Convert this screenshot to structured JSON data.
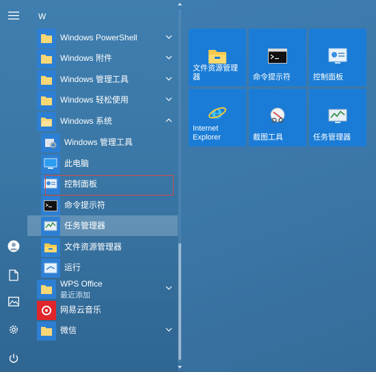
{
  "app_list": {
    "section_letter": "W",
    "items": [
      {
        "label": "Windows PowerShell",
        "icon": "folder-icon"
      },
      {
        "label": "Windows 附件",
        "icon": "folder-icon"
      },
      {
        "label": "Windows 管理工具",
        "icon": "folder-icon"
      },
      {
        "label": "Windows 轻松使用",
        "icon": "folder-icon"
      },
      {
        "label": "Windows 系统",
        "icon": "folder-icon"
      },
      {
        "label": "Windows 管理工具",
        "icon": "admin-tools-icon"
      },
      {
        "label": "此电脑",
        "icon": "this-pc-icon"
      },
      {
        "label": "控制面板",
        "icon": "control-panel-icon"
      },
      {
        "label": "命令提示符",
        "icon": "cmd-icon"
      },
      {
        "label": "任务管理器",
        "icon": "task-manager-icon"
      },
      {
        "label": "文件资源管理器",
        "icon": "file-explorer-icon"
      },
      {
        "label": "运行",
        "icon": "run-icon"
      },
      {
        "label": "WPS Office",
        "sublabel": "最近添加",
        "icon": "folder-icon"
      },
      {
        "label": "网易云音乐",
        "icon": "netease-music-icon"
      },
      {
        "label": "微信",
        "icon": "folder-icon"
      }
    ]
  },
  "tiles": [
    {
      "label": "文件资源管理器",
      "icon": "file-explorer-icon"
    },
    {
      "label": "命令提示符",
      "icon": "cmd-icon"
    },
    {
      "label": "控制面板",
      "icon": "control-panel-icon"
    },
    {
      "label": "Internet Explorer",
      "icon": "internet-explorer-icon"
    },
    {
      "label": "截图工具",
      "icon": "snipping-tool-icon"
    },
    {
      "label": "任务管理器",
      "icon": "task-manager-icon"
    }
  ],
  "colors": {
    "tile": "#1a7cd6",
    "highlight": "#d24a4a",
    "netease": "#e0262b"
  }
}
